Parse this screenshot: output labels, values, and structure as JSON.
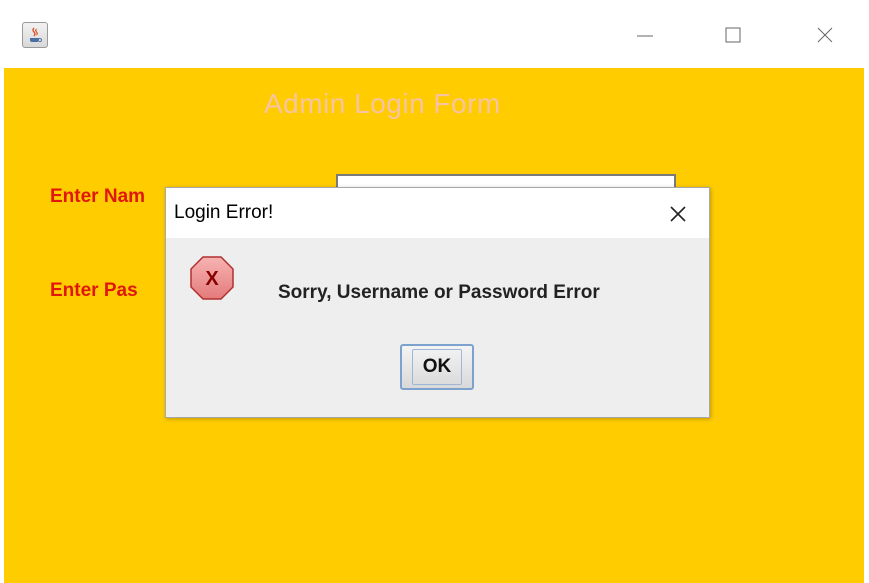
{
  "window": {
    "icon": "java-coffee-cup-icon",
    "controls": [
      "minimize-icon",
      "maximize-icon",
      "close-icon"
    ]
  },
  "form": {
    "title": "Admin Login Form",
    "name_label": "Enter Nam",
    "password_label": "Enter Pas",
    "name_value": ""
  },
  "dialog": {
    "title": "Login Error!",
    "message": "Sorry, Username or Password Error",
    "ok_label": "OK",
    "icon": "error-icon"
  },
  "colors": {
    "background": "#ffcc00",
    "label": "#e0170c",
    "title": "#f6c4a0",
    "dialog_bg": "#eeeeee"
  }
}
